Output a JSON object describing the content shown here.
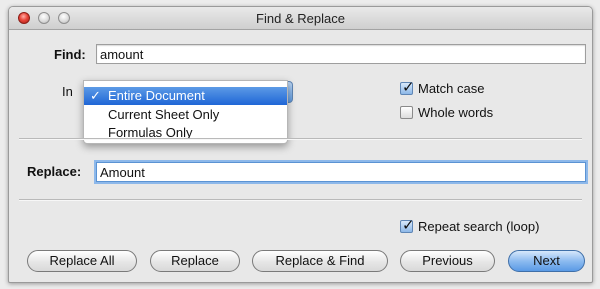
{
  "window": {
    "title": "Find & Replace"
  },
  "find": {
    "label": "Find:",
    "value": "amount"
  },
  "in": {
    "label": "In",
    "options": [
      "Entire Document",
      "Current Sheet Only",
      "Formulas Only"
    ],
    "selected_check": "✓"
  },
  "options": {
    "match_case": {
      "label": "Match case",
      "checked": true
    },
    "whole_words": {
      "label": "Whole words",
      "checked": false
    }
  },
  "replace": {
    "label": "Replace:",
    "value": "Amount"
  },
  "repeat_search": {
    "label": "Repeat search (loop)",
    "checked": true
  },
  "buttons": {
    "replace_all": "Replace All",
    "replace": "Replace",
    "replace_and_find": "Replace & Find",
    "previous": "Previous",
    "next": "Next"
  },
  "colors": {
    "accent": "#1f66d6",
    "close": "#e9453a"
  }
}
